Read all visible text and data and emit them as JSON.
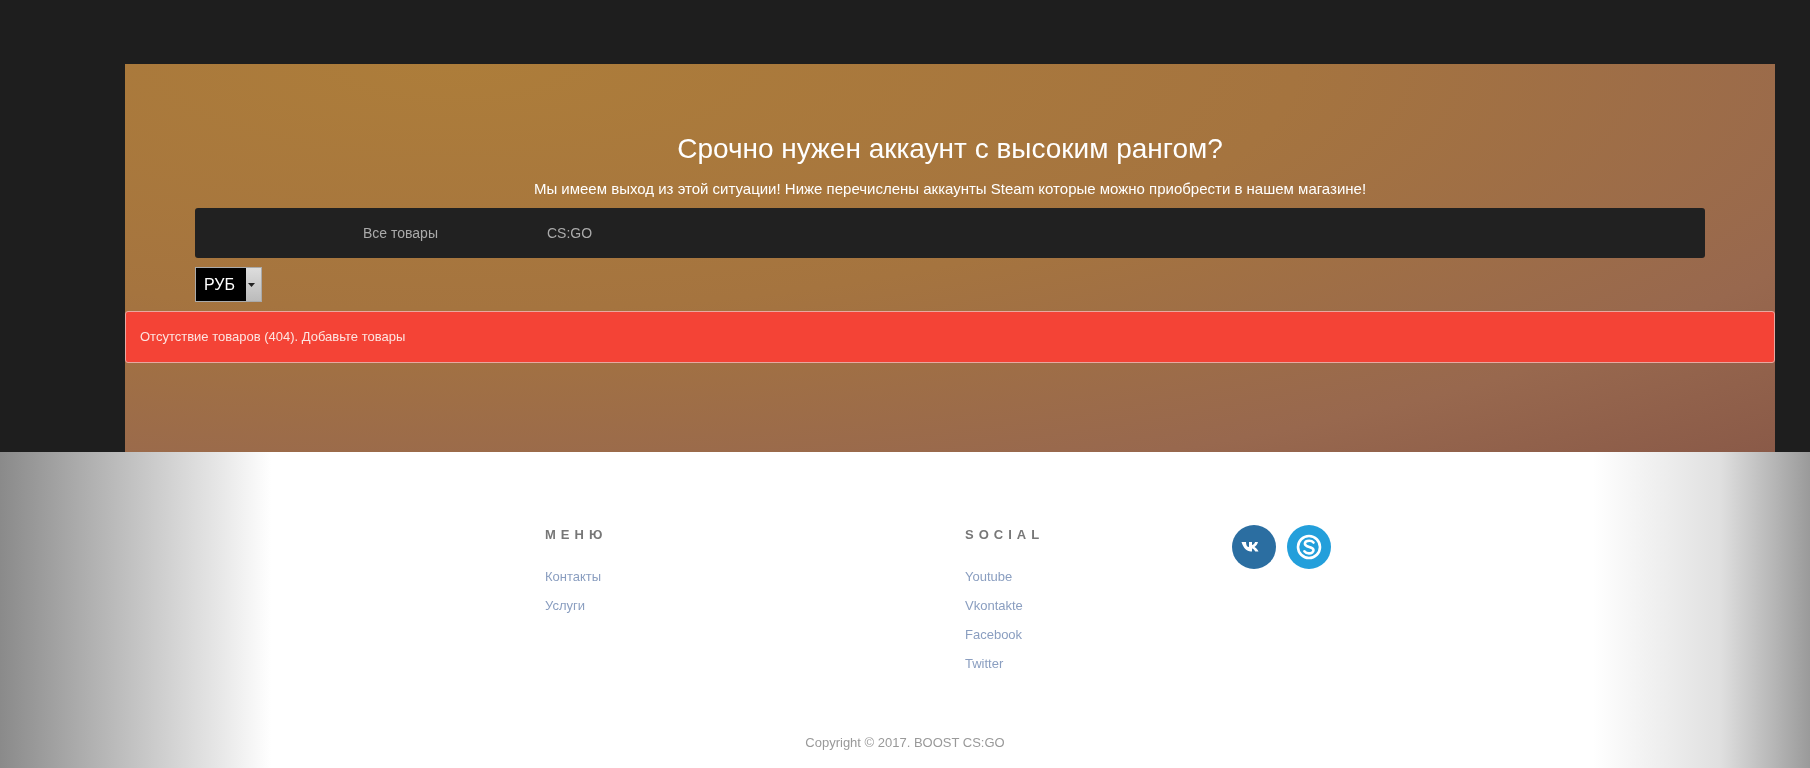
{
  "hero": {
    "title": "Срочно нужен аккаунт с высоким рангом?",
    "subtitle": "Мы имеем выход из этой ситуации! Ниже перечислены аккаунты Steam которые можно приобрести в нашем магазине!"
  },
  "nav": [
    {
      "label": "Все товары"
    },
    {
      "label": "CS:GO"
    }
  ],
  "currency": {
    "value": "РУБ"
  },
  "alert": {
    "text": "Отсутствие товаров (404). Добавьте товары"
  },
  "footer": {
    "columns": [
      {
        "heading": "МЕНЮ",
        "links": [
          "Контакты",
          "Услуги"
        ]
      },
      {
        "heading": "SOCIAL",
        "links": [
          "Youtube",
          "Vkontakte",
          "Facebook",
          "Twitter"
        ]
      }
    ],
    "social_icons": [
      {
        "kind": "vk",
        "color": "#2b6ea1"
      },
      {
        "kind": "skype",
        "color": "#239fdb"
      }
    ],
    "copyright": "Copyright © 2017. BOOST CS:GO"
  }
}
